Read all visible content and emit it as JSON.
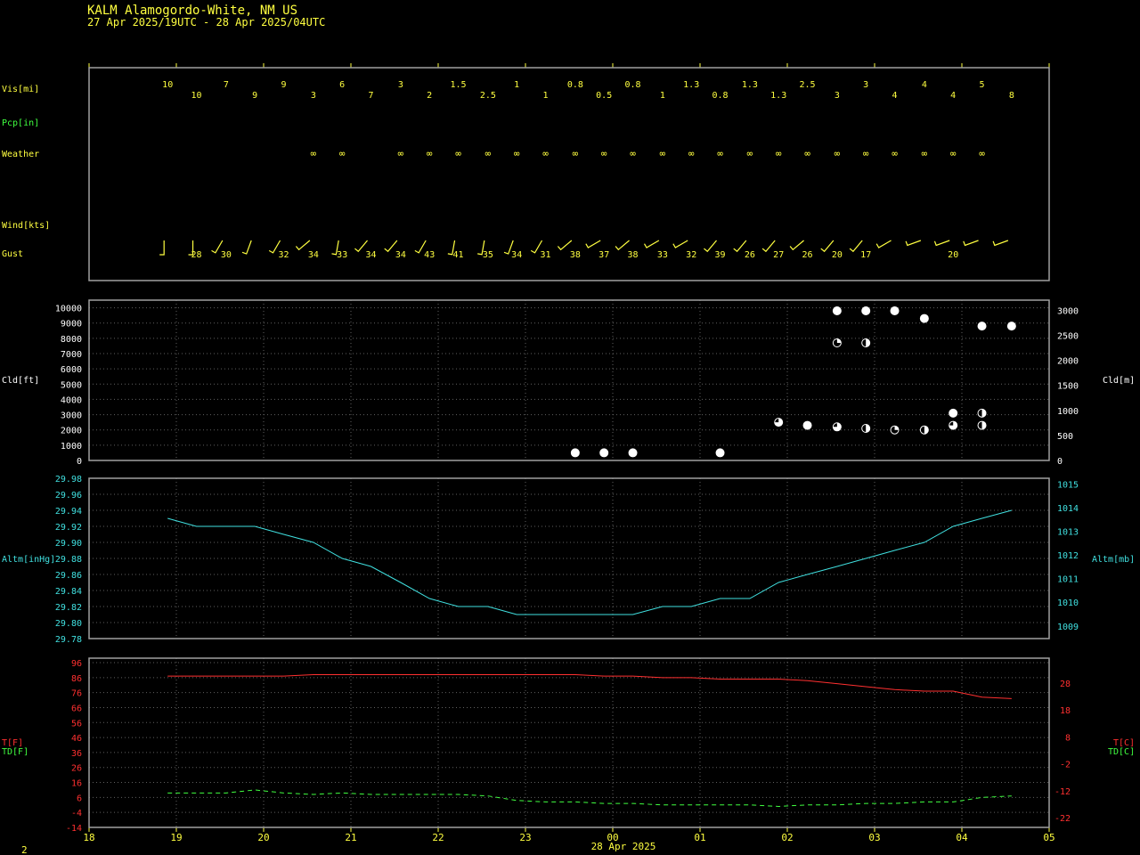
{
  "header": {
    "station": "KALM  Alamogordo-White, NM US",
    "period": "27 Apr 2025/19UTC - 28 Apr 2025/04UTC",
    "corner": "2",
    "date_label": "28 Apr 2025"
  },
  "colors": {
    "background": "#000000",
    "frame": "#a0a0a0",
    "grid": "#606060",
    "yellow": "#ffff40",
    "green": "#40ff40",
    "cyan": "#40e0e0",
    "red": "#ff3030",
    "white": "#ffffff"
  },
  "chart_data": {
    "type": "line",
    "x_axis": {
      "ticks": [
        "18",
        "19",
        "20",
        "21",
        "22",
        "23",
        "00",
        "01",
        "02",
        "03",
        "04",
        "05"
      ],
      "xlim": [
        18,
        29
      ]
    },
    "times": [
      18.9,
      19.23,
      19.57,
      19.9,
      20.23,
      20.57,
      20.9,
      21.23,
      21.57,
      21.9,
      22.23,
      22.57,
      22.9,
      23.23,
      23.57,
      23.9,
      24.23,
      24.57,
      24.9,
      25.23,
      25.57,
      25.9,
      26.23,
      26.57,
      26.9,
      27.23,
      27.57,
      27.9,
      28.23,
      28.57
    ],
    "info_panel": {
      "row_labels": {
        "vis": "Vis[mi]",
        "pcp": "Pcp[in]",
        "weather": "Weather",
        "wind": "Wind[kts]",
        "gust": "Gust"
      },
      "vis": [
        "10",
        "10",
        "7",
        "9",
        "9",
        "3",
        "6",
        "7",
        "3",
        "2",
        "1.5",
        "2.5",
        "1",
        "1",
        "0.8",
        "0.5",
        "0.8",
        "1",
        "1.3",
        "0.8",
        "1.3",
        "1.3",
        "2.5",
        "3",
        "3",
        "4",
        "4",
        "4",
        "5",
        "8"
      ],
      "weather": [
        "",
        "",
        "",
        "",
        "",
        "∞",
        "∞",
        "",
        "∞",
        "∞",
        "∞",
        "∞",
        "∞",
        "∞",
        "∞",
        "∞",
        "∞",
        "∞",
        "∞",
        "∞",
        "∞",
        "∞",
        "∞",
        "∞",
        "∞",
        "∞",
        "∞",
        "∞",
        "∞",
        ""
      ],
      "wind_dir": [
        180,
        180,
        210,
        200,
        210,
        230,
        190,
        220,
        220,
        210,
        190,
        190,
        200,
        210,
        230,
        240,
        230,
        240,
        240,
        220,
        220,
        220,
        230,
        220,
        220,
        240,
        250,
        250,
        250,
        250
      ],
      "gust": [
        "",
        "28",
        "30",
        "",
        "32",
        "34",
        "33",
        "34",
        "34",
        "43",
        "41",
        "35",
        "34",
        "31",
        "38",
        "37",
        "38",
        "33",
        "32",
        "39",
        "26",
        "27",
        "26",
        "20",
        "17",
        "",
        "",
        "20",
        "",
        ""
      ]
    },
    "cloud_panel": {
      "ylabel": "Cld[ft]",
      "y2label": "Cld[m]",
      "ylim": [
        0,
        10500
      ],
      "ticks": [
        0,
        1000,
        2000,
        3000,
        4000,
        5000,
        6000,
        7000,
        8000,
        9000,
        10000
      ],
      "y2ticks": [
        0,
        500,
        1000,
        1500,
        2000,
        2500,
        3000
      ],
      "layers": [
        {
          "x": 23.57,
          "ft": 500,
          "cover": 4
        },
        {
          "x": 23.9,
          "ft": 500,
          "cover": 4
        },
        {
          "x": 24.23,
          "ft": 500,
          "cover": 4
        },
        {
          "x": 25.23,
          "ft": 500,
          "cover": 4
        },
        {
          "x": 25.9,
          "ft": 2500,
          "cover": 3
        },
        {
          "x": 26.23,
          "ft": 2300,
          "cover": 4
        },
        {
          "x": 26.57,
          "ft": 2200,
          "cover": 3
        },
        {
          "x": 26.57,
          "ft": 7700,
          "cover": 1
        },
        {
          "x": 26.57,
          "ft": 9800,
          "cover": 4
        },
        {
          "x": 26.9,
          "ft": 2100,
          "cover": 2
        },
        {
          "x": 26.9,
          "ft": 7700,
          "cover": 2
        },
        {
          "x": 26.9,
          "ft": 9800,
          "cover": 4
        },
        {
          "x": 27.23,
          "ft": 2000,
          "cover": 1
        },
        {
          "x": 27.23,
          "ft": 9800,
          "cover": 4
        },
        {
          "x": 27.57,
          "ft": 2000,
          "cover": 2
        },
        {
          "x": 27.57,
          "ft": 9300,
          "cover": 4
        },
        {
          "x": 27.9,
          "ft": 2300,
          "cover": 3
        },
        {
          "x": 27.9,
          "ft": 3100,
          "cover": 4
        },
        {
          "x": 28.23,
          "ft": 2300,
          "cover": 2
        },
        {
          "x": 28.23,
          "ft": 3100,
          "cover": 2
        },
        {
          "x": 28.23,
          "ft": 8800,
          "cover": 4
        },
        {
          "x": 28.57,
          "ft": 8800,
          "cover": 4
        }
      ]
    },
    "altimeter_panel": {
      "ylabel": "Altm[inHg]",
      "y2label": "Altm[mb]",
      "ylim": [
        29.78,
        29.98
      ],
      "ticks": [
        "29.78",
        "29.80",
        "29.82",
        "29.84",
        "29.86",
        "29.88",
        "29.90",
        "29.92",
        "29.94",
        "29.96",
        "29.98"
      ],
      "y2ticks": [
        1009,
        1010,
        1011,
        1012,
        1013,
        1014,
        1015
      ],
      "values": [
        29.93,
        29.92,
        29.92,
        29.92,
        29.91,
        29.9,
        29.88,
        29.87,
        29.85,
        29.83,
        29.82,
        29.82,
        29.81,
        29.81,
        29.81,
        29.81,
        29.81,
        29.82,
        29.82,
        29.83,
        29.83,
        29.85,
        29.86,
        29.87,
        29.88,
        29.89,
        29.9,
        29.92,
        29.93,
        29.94
      ]
    },
    "temp_panel": {
      "ylabel_t": "T[F]",
      "ylabel_td": "TD[F]",
      "y2label_t": "T[C]",
      "y2label_td": "TD[C]",
      "ylim": [
        -14,
        99
      ],
      "ticks": [
        "-14",
        "-4",
        "6",
        "16",
        "26",
        "36",
        "46",
        "56",
        "66",
        "76",
        "86",
        "96"
      ],
      "y2ticks": [
        "-22",
        "-12",
        "-2",
        "8",
        "18",
        "28"
      ],
      "series": [
        {
          "name": "T",
          "values": [
            87,
            87,
            87,
            87,
            87,
            88,
            88,
            88,
            88,
            88,
            88,
            88,
            88,
            88,
            88,
            87,
            87,
            86,
            86,
            85,
            85,
            85,
            84,
            82,
            80,
            78,
            77,
            77,
            73,
            72
          ]
        },
        {
          "name": "TD",
          "values": [
            9,
            9,
            9,
            11,
            9,
            8,
            9,
            8,
            8,
            8,
            8,
            7,
            4,
            3,
            3,
            2,
            2,
            1,
            1,
            1,
            1,
            0,
            1,
            1,
            2,
            2,
            3,
            3,
            6,
            7
          ]
        }
      ]
    }
  }
}
